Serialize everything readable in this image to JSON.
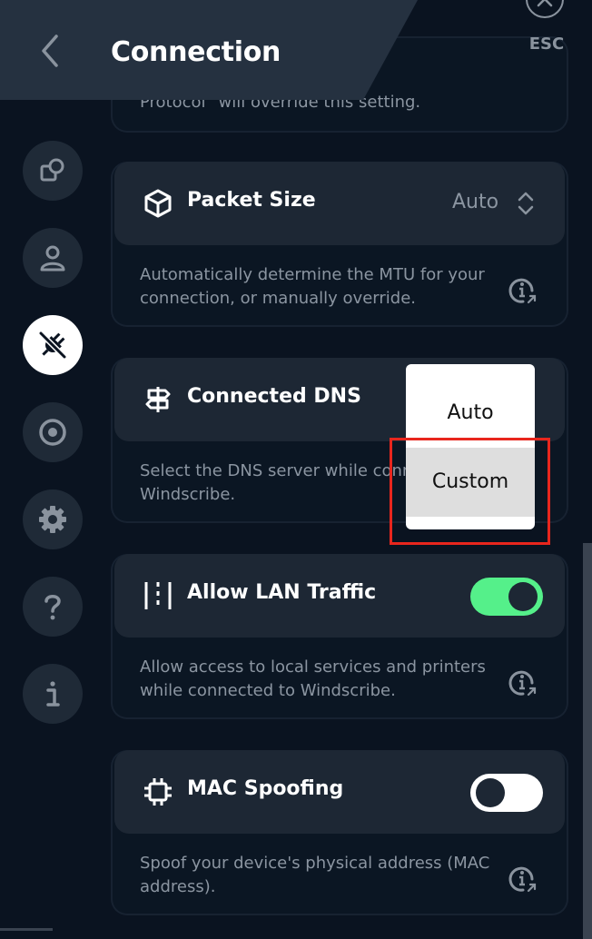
{
  "header": {
    "title": "Connection",
    "esc_label": "ESC"
  },
  "sidebar": {
    "items": [
      {
        "name": "windows-icon",
        "active": false
      },
      {
        "name": "account-icon",
        "active": false
      },
      {
        "name": "plug-icon",
        "active": true
      },
      {
        "name": "robert-icon",
        "active": false
      },
      {
        "name": "gear-icon",
        "active": false
      },
      {
        "name": "help-icon",
        "active": false
      },
      {
        "name": "info-icon",
        "active": false
      }
    ]
  },
  "cards": {
    "top_partial": {
      "description": "Protocol\" will override this setting."
    },
    "packet_size": {
      "title": "Packet Size",
      "value": "Auto",
      "description": "Automatically determine the MTU for your connection, or manually override."
    },
    "connected_dns": {
      "title": "Connected DNS",
      "description_line1": "Select the DNS server while conn",
      "description_line2": "Windscribe."
    },
    "allow_lan": {
      "title": "Allow LAN Traffic",
      "enabled": true,
      "description": "Allow access to local services and printers while connected to Windscribe."
    },
    "mac_spoofing": {
      "title": "MAC Spoofing",
      "enabled": false,
      "description": "Spoof your device's physical address (MAC address)."
    }
  },
  "dns_dropdown": {
    "options": [
      "Auto",
      "Custom"
    ],
    "selected": "Custom"
  },
  "colors": {
    "background": "#0a1320",
    "card_head": "#1d2734",
    "toggle_on": "#55f08a",
    "highlight": "#e8261d"
  }
}
